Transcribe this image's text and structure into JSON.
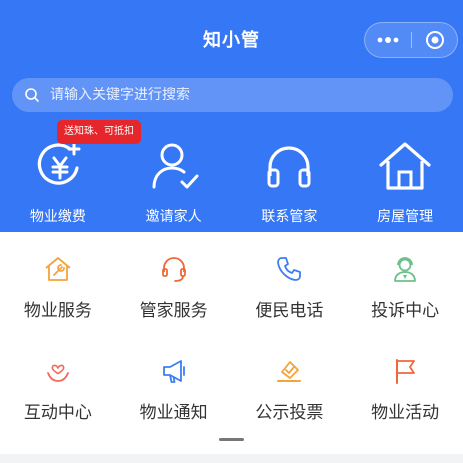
{
  "app": {
    "title": "知小管"
  },
  "capsule": {
    "more_icon": "more-icon",
    "close_icon": "capsule-close-icon"
  },
  "search": {
    "placeholder": "请输入关键字进行搜索",
    "icon": "search-icon"
  },
  "badge": {
    "text": "送知珠、可抵扣"
  },
  "top_menu": [
    {
      "label": "物业缴费",
      "icon": "yen-payment-icon"
    },
    {
      "label": "邀请家人",
      "icon": "invite-user-icon"
    },
    {
      "label": "联系管家",
      "icon": "headphones-icon"
    },
    {
      "label": "房屋管理",
      "icon": "house-icon"
    }
  ],
  "grid_menu": [
    {
      "label": "物业服务",
      "icon": "wrench-house-icon",
      "color": "#f5a33a"
    },
    {
      "label": "管家服务",
      "icon": "headset-icon",
      "color": "#f0683a"
    },
    {
      "label": "便民电话",
      "icon": "phone-icon",
      "color": "#3d7ef6"
    },
    {
      "label": "投诉中心",
      "icon": "agent-icon",
      "color": "#6cc08b"
    },
    {
      "label": "互动中心",
      "icon": "heart-hand-icon",
      "color": "#f06a5a"
    },
    {
      "label": "物业通知",
      "icon": "megaphone-icon",
      "color": "#3d7ef6"
    },
    {
      "label": "公示投票",
      "icon": "vote-icon",
      "color": "#f5a33a"
    },
    {
      "label": "物业活动",
      "icon": "flag-icon",
      "color": "#f0683a"
    }
  ]
}
